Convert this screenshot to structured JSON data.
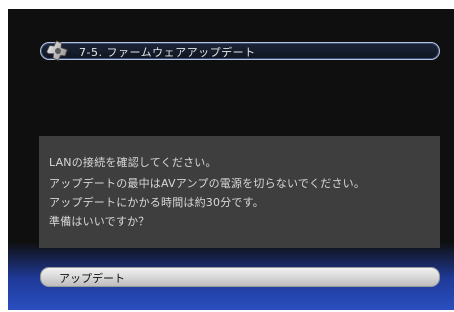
{
  "header": {
    "title": "7-5. ファームウェアアップデート",
    "icon": "gear-icon"
  },
  "message": {
    "lines": [
      "LANの接続を確認してください。",
      "アップデートの最中はAVアンプの電源を切らないでください。",
      "アップデートにかかる時間は約30分です。",
      "準備はいいですか？"
    ]
  },
  "actions": {
    "update_label": "アップデート"
  },
  "colors": {
    "background": "#0f0f0f",
    "message_box": "#3e3e3e",
    "accent_blue": "#2a4fc0",
    "button": "#d6d6d6"
  }
}
